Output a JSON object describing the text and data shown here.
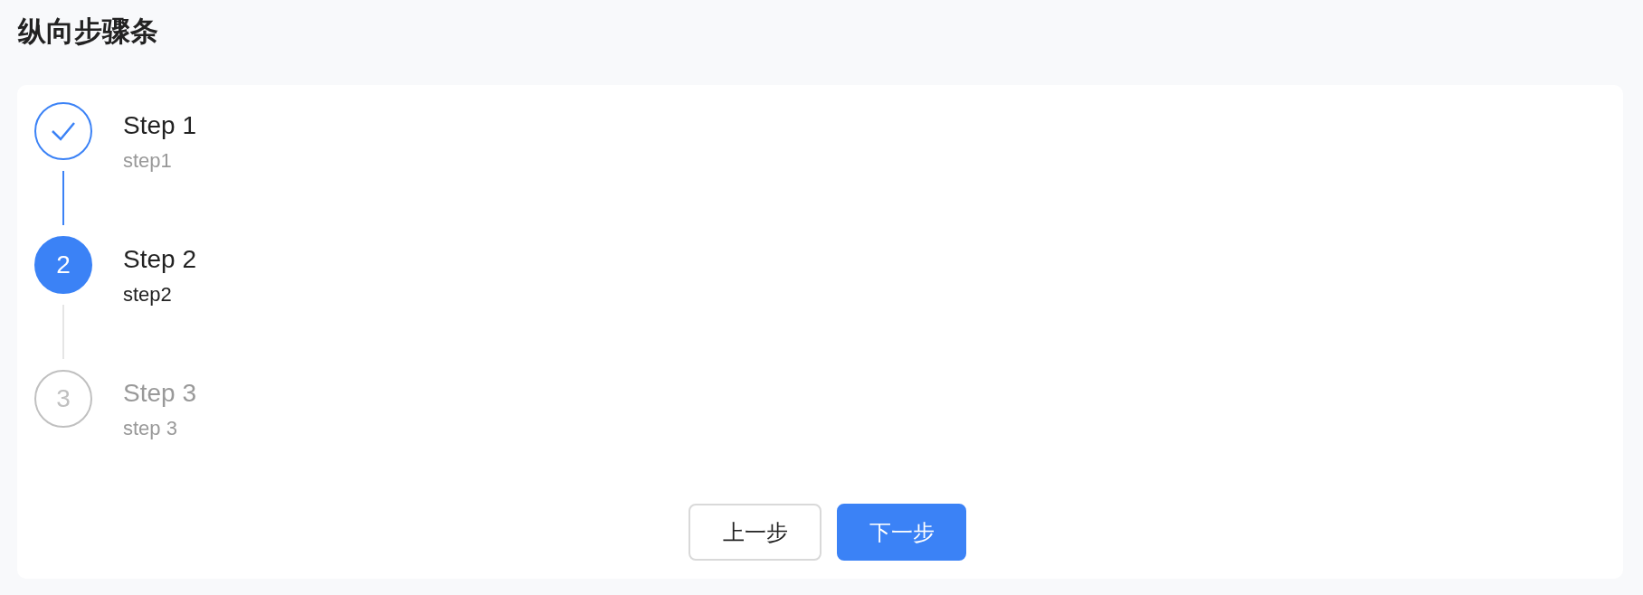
{
  "page_title": "纵向步骤条",
  "steps": [
    {
      "kind": "finish",
      "title": "Step 1",
      "description": "step1"
    },
    {
      "kind": "process",
      "number": "2",
      "title": "Step 2",
      "description": "step2"
    },
    {
      "kind": "wait",
      "number": "3",
      "title": "Step 3",
      "description": "step 3"
    }
  ],
  "buttons": [
    {
      "kind": "default",
      "label": "上一步"
    },
    {
      "kind": "primary",
      "label": "下一步"
    }
  ]
}
